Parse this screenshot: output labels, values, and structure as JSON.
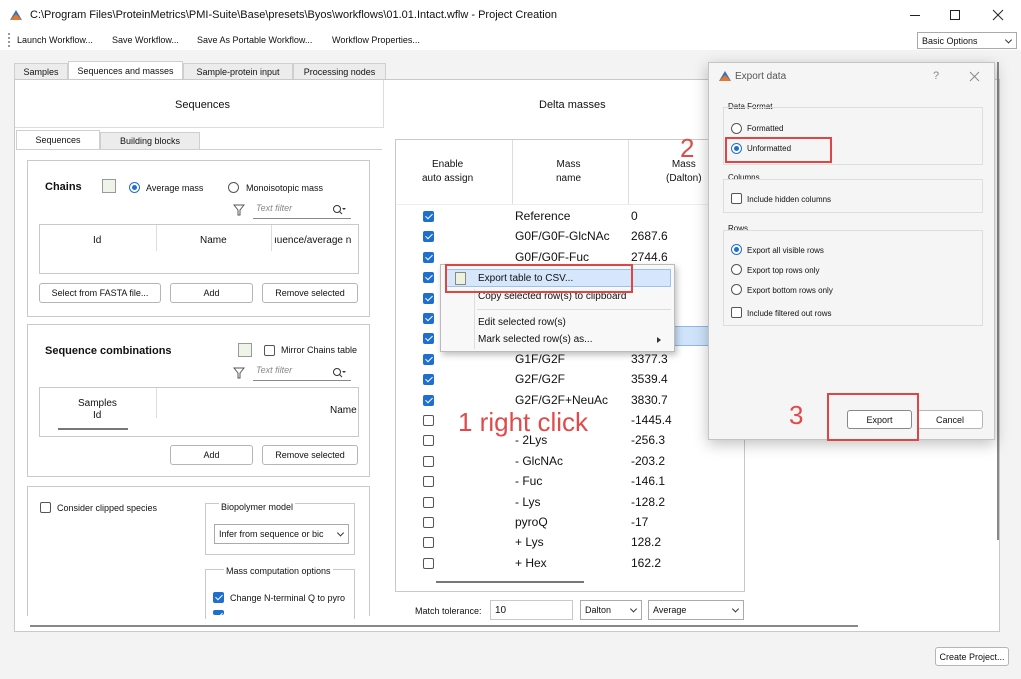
{
  "window": {
    "title": "C:\\Program Files\\ProteinMetrics\\PMI-Suite\\Base\\presets\\Byos\\workflows\\01.01.Intact.wflw - Project Creation"
  },
  "toolbar": {
    "launch": "Launch Workflow...",
    "save": "Save Workflow...",
    "save_portable": "Save As Portable Workflow...",
    "properties": "Workflow Properties...",
    "options_dropdown": "Basic Options"
  },
  "main_tabs": [
    "Samples",
    "Sequences and masses",
    "Sample-protein input",
    "Processing nodes"
  ],
  "sequences": {
    "header": "Sequences",
    "tabs": [
      "Sequences",
      "Building blocks"
    ],
    "chains": {
      "title": "Chains",
      "radio_average": "Average mass",
      "radio_mono": "Monoisotopic mass",
      "filter_placeholder": "Text filter",
      "columns": [
        "Id",
        "Name",
        "ıuence/average n"
      ],
      "btn_fasta": "Select from FASTA file...",
      "btn_add": "Add",
      "btn_remove": "Remove selected"
    },
    "combinations": {
      "title": "Sequence combinations",
      "mirror": "Mirror Chains table",
      "filter_placeholder": "Text filter",
      "col_samples": "Samples",
      "col_id": "Id",
      "col_name": "Name",
      "btn_add": "Add",
      "btn_remove": "Remove selected"
    },
    "bottom": {
      "clipped": "Consider clipped species",
      "biopolymer_label": "Biopolymer model",
      "biopolymer_value": "Infer from sequence or bic",
      "mass_opts_label": "Mass computation options",
      "nterm": "Change N-terminal Q to pyro"
    }
  },
  "delta": {
    "header": "Delta masses",
    "col_enable": "Enable\nauto assign",
    "col_name": "Mass\nname",
    "col_mass": "Mass\n(Dalton)",
    "rows": [
      {
        "checked": true,
        "name": "Reference",
        "mass": "0"
      },
      {
        "checked": true,
        "name": "G0F/G0F-GlcNAc",
        "mass": "2687.6"
      },
      {
        "checked": true,
        "name": "G0F/G0F-Fuc",
        "mass": "2744.6"
      },
      {
        "checked": true,
        "name": "",
        "mass": ""
      },
      {
        "checked": true,
        "name": "",
        "mass": ""
      },
      {
        "checked": true,
        "name": "",
        "mass": ""
      },
      {
        "checked": true,
        "name": "",
        "mass": ""
      },
      {
        "checked": true,
        "name": "G1F/G2F",
        "mass": "3377.3"
      },
      {
        "checked": true,
        "name": "G2F/G2F",
        "mass": "3539.4"
      },
      {
        "checked": true,
        "name": "G2F/G2F+NeuAc",
        "mass": "3830.7"
      },
      {
        "checked": false,
        "name": "",
        "mass": "-1445.4"
      },
      {
        "checked": false,
        "name": "- 2Lys",
        "mass": "-256.3"
      },
      {
        "checked": false,
        "name": "- GlcNAc",
        "mass": "-203.2"
      },
      {
        "checked": false,
        "name": "- Fuc",
        "mass": "-146.1"
      },
      {
        "checked": false,
        "name": "- Lys",
        "mass": "-128.2"
      },
      {
        "checked": false,
        "name": "pyroQ",
        "mass": "-17"
      },
      {
        "checked": false,
        "name": "+ Lys",
        "mass": "128.2"
      },
      {
        "checked": false,
        "name": "+ Hex",
        "mass": "162.2"
      }
    ],
    "tolerance_label": "Match tolerance:",
    "tolerance_value": "10",
    "unit": "Dalton",
    "mode": "Average"
  },
  "context_menu": {
    "items": [
      "Export table to CSV...",
      "Copy selected row(s) to clipboard",
      "Edit selected row(s)",
      "Mark selected row(s) as..."
    ]
  },
  "dialog": {
    "title": "Export data",
    "help": "?",
    "format_group": "Data Format",
    "formatted": "Formatted",
    "unformatted": "Unformatted",
    "columns_group": "Columns",
    "hidden_cols": "Include hidden columns",
    "rows_group": "Rows",
    "all_rows": "Export all visible rows",
    "top_rows": "Export top rows only",
    "bottom_rows": "Export bottom rows only",
    "filtered": "Include filtered out rows",
    "export_btn": "Export",
    "cancel_btn": "Cancel"
  },
  "annotations": {
    "step1": "1 right click",
    "step2": "2",
    "step3": "3"
  },
  "footer": {
    "create": "Create Project..."
  },
  "colors": {
    "accent": "#1f6fd1",
    "annotation_red": "#e24a4a",
    "menu_highlight": "#d6e6fb",
    "row_selected": "#cfe3fb"
  }
}
